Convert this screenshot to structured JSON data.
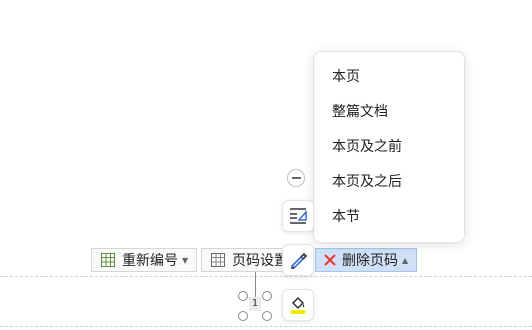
{
  "toolbar": {
    "renumber_label": "重新编号",
    "page_setup_label": "页码设置",
    "delete_label": "删除页码"
  },
  "menu": {
    "items": [
      {
        "label": "本页"
      },
      {
        "label": "整篇文档"
      },
      {
        "label": "本页及之前"
      },
      {
        "label": "本页及之后"
      },
      {
        "label": "本节"
      }
    ]
  },
  "page_number": {
    "value": "1"
  },
  "colors": {
    "delete_icon": "#e53935",
    "active_button_bg": "#cfe0f7",
    "highlight_bar": "#f2e600",
    "pen_icon": "#3b6fd1"
  },
  "icons": {
    "renumber": "renumber-icon",
    "page_setup": "page-setup-icon",
    "delete": "close-x-icon",
    "side": [
      "minus-icon",
      "align-lines-icon",
      "pen-icon",
      "fill-bucket-icon"
    ]
  }
}
